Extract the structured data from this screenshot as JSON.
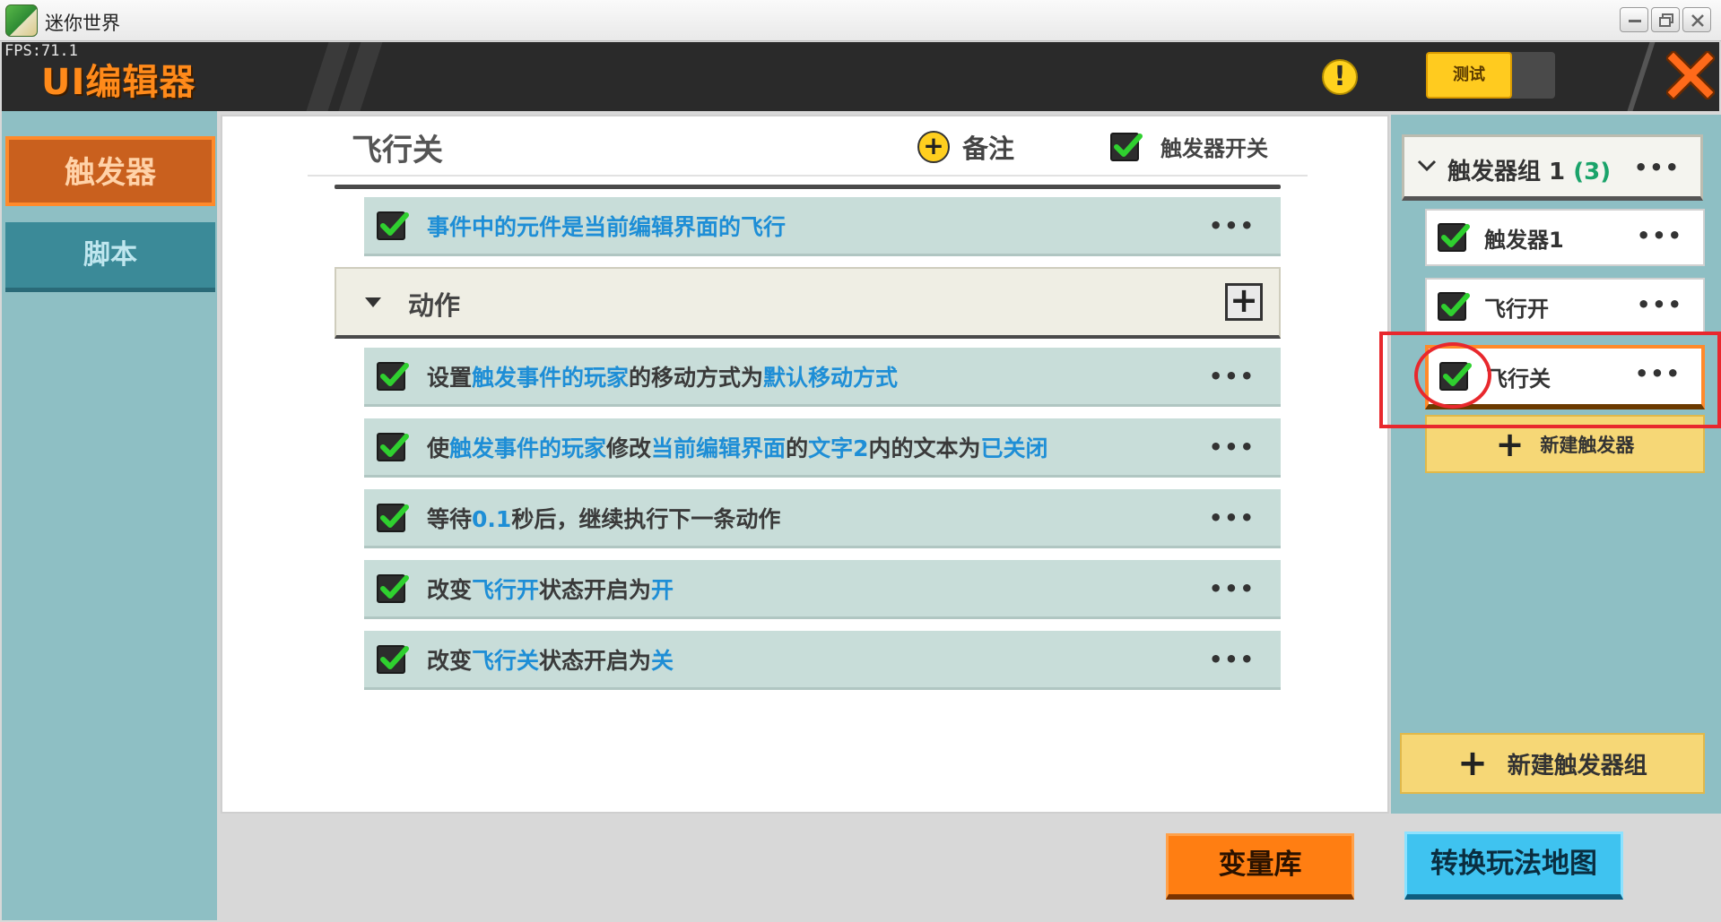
{
  "window": {
    "title": "迷你世界"
  },
  "header": {
    "fps": "FPS:71.1",
    "title": "UI编辑器",
    "test_label": "测试"
  },
  "left_tabs": [
    {
      "label": "触发器"
    },
    {
      "label": "脚本"
    }
  ],
  "editor": {
    "trigger_name": "飞行关",
    "note_label": "备注",
    "switch_label": "触发器开关",
    "condition": {
      "parts": [
        "事件中的元件是当前编辑界面的飞行"
      ]
    },
    "action_section_label": "动作",
    "actions": [
      {
        "t1": "设置",
        "b1": "触发事件的玩家",
        "t2": "的移动方式为",
        "b2": "默认移动方式"
      },
      {
        "t1": "使",
        "b1": "触发事件的玩家",
        "t2": "修改",
        "b2": "当前编辑界面",
        "t3": "的",
        "b3": "文字2",
        "t4": "内的文本为",
        "b4": "已关闭"
      },
      {
        "t1": "等待",
        "b1": "0.1",
        "t2": "秒后，继续执行下一条动作"
      },
      {
        "t1": "改变",
        "b1": "飞行开",
        "t2": "状态开启为",
        "b2": "开"
      },
      {
        "t1": "改变",
        "b1": "飞行关",
        "t2": "状态开启为",
        "b2": "关"
      }
    ]
  },
  "right_panel": {
    "group_label": "触发器组 1",
    "group_count": "(3)",
    "triggers": [
      "触发器1",
      "飞行开",
      "飞行关"
    ],
    "selected_index": 2,
    "new_trigger_label": "新建触发器",
    "new_group_label": "新建触发器组"
  },
  "bottom": {
    "variables_label": "变量库",
    "convert_label": "转换玩法地图"
  },
  "colors": {
    "accent_orange": "#ff7e12",
    "highlight_blue": "#1e8ed6",
    "annotation_red": "#e8282d"
  }
}
